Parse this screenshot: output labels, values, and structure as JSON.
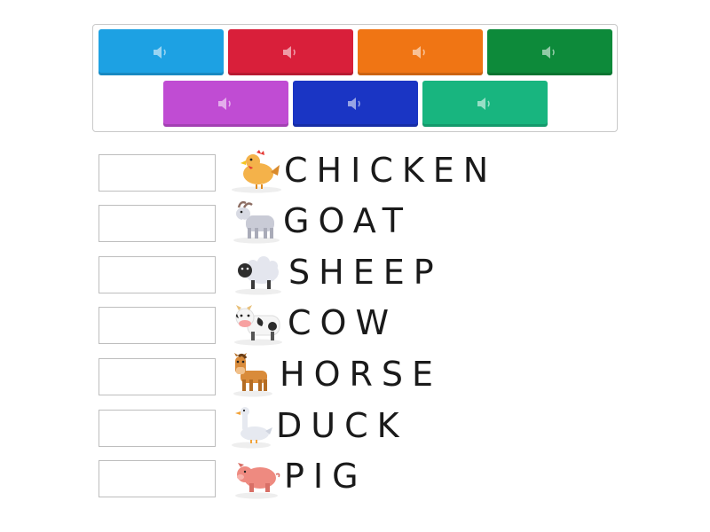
{
  "tiles": [
    {
      "color": "#1da1e3",
      "icon": "speaker-icon"
    },
    {
      "color": "#d91f3a",
      "icon": "speaker-icon"
    },
    {
      "color": "#f07514",
      "icon": "speaker-icon"
    },
    {
      "color": "#0d8a3a",
      "icon": "speaker-icon"
    },
    {
      "color": "#c04cd3",
      "icon": "speaker-icon"
    },
    {
      "color": "#1a35c4",
      "icon": "speaker-icon"
    },
    {
      "color": "#18b57f",
      "icon": "speaker-icon"
    }
  ],
  "rows": [
    {
      "word": "CHICKEN",
      "animal": "chicken-icon"
    },
    {
      "word": "GOAT",
      "animal": "goat-icon"
    },
    {
      "word": "SHEEP",
      "animal": "sheep-icon"
    },
    {
      "word": "COW",
      "animal": "cow-icon"
    },
    {
      "word": "HORSE",
      "animal": "horse-icon"
    },
    {
      "word": "DUCK",
      "animal": "duck-icon"
    },
    {
      "word": "PIG",
      "animal": "pig-icon"
    }
  ]
}
